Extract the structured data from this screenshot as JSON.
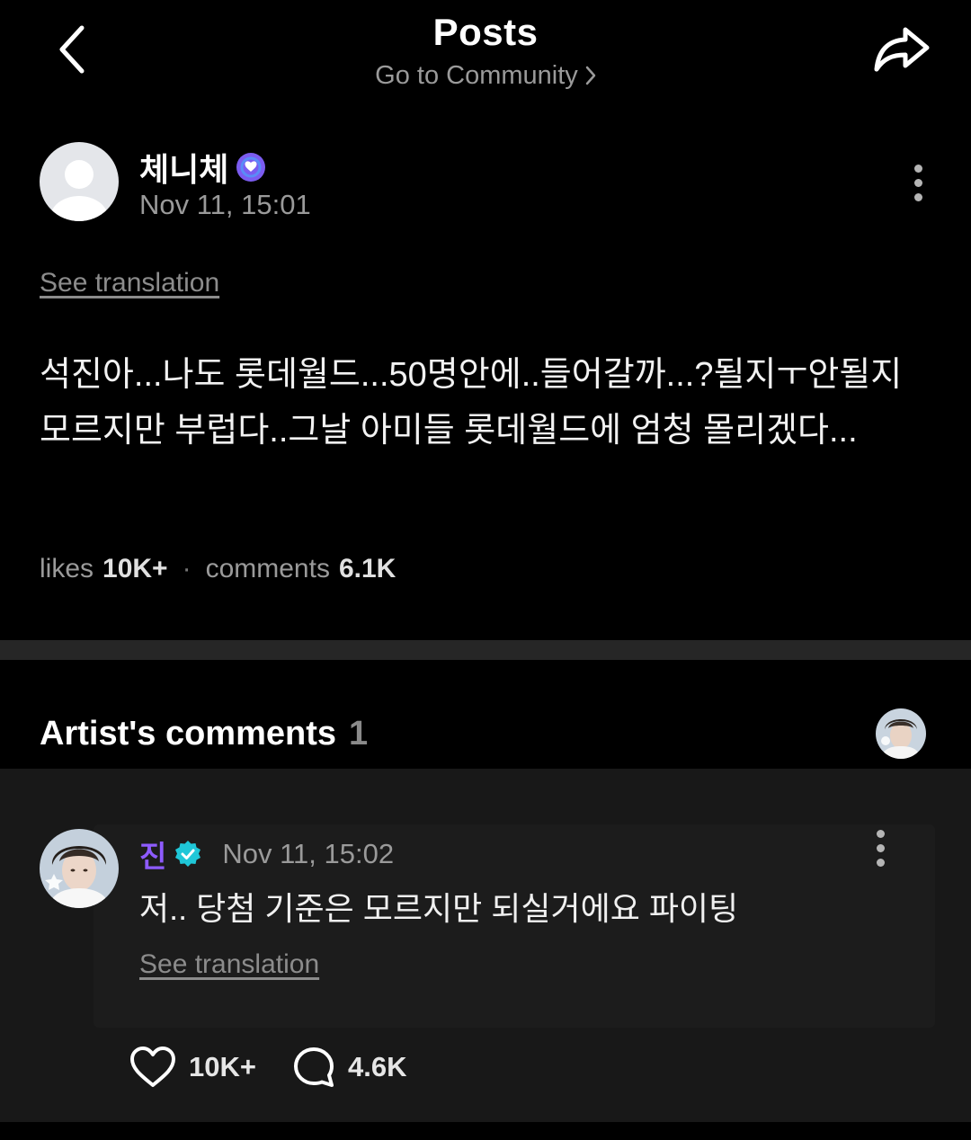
{
  "header": {
    "title": "Posts",
    "community_link": "Go to Community"
  },
  "post": {
    "author": "체니체",
    "timestamp": "Nov 11, 15:01",
    "see_translation": "See translation",
    "body": "석진아...나도 롯데월드...50명안에..들어갈까...?될지ㅜ안될지 모르지만 부럽다..그날 아미들 롯데월드에 엄청 몰리겠다...",
    "likes_label": "likes",
    "likes_count": "10K+",
    "comments_label": "comments",
    "comments_count": "6.1K"
  },
  "artist_comments": {
    "title": "Artist's comments",
    "count": "1",
    "comment": {
      "author": "진",
      "timestamp": "Nov 11, 15:02",
      "text": "저.. 당첨 기준은 모르지만 되실거에요 파이팅",
      "see_translation": "See translation",
      "likes": "10K+",
      "replies": "4.6K"
    }
  },
  "colors": {
    "background": "#000000",
    "comment_bg": "#181818",
    "artist_name": "#8e5bff",
    "verified_purple": "#7b5cf0",
    "verified_cyan": "#1fc7d8"
  },
  "icons": [
    "back-arrow-icon",
    "share-icon",
    "chevron-right-icon",
    "verified-badge-icon",
    "more-vertical-icon",
    "heart-icon",
    "comment-bubble-icon"
  ]
}
